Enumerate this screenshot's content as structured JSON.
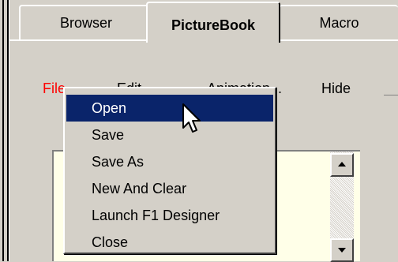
{
  "tabs": [
    {
      "label": "Browser",
      "active": false
    },
    {
      "label": "PictureBook",
      "active": true
    },
    {
      "label": "Macro",
      "active": false
    }
  ],
  "menubar": {
    "file": "File",
    "edit": "Edit",
    "animation": "Animation...",
    "hide": "Hide"
  },
  "dropdown": {
    "items": [
      {
        "label": "Open",
        "selected": true
      },
      {
        "label": "Save"
      },
      {
        "label": "Save As"
      },
      {
        "label": "New And Clear"
      },
      {
        "label": "Launch F1 Designer"
      },
      {
        "label": "Close"
      }
    ]
  },
  "colors": {
    "window_bg": "#d4d0c8",
    "menu_selection": "#0a246a",
    "active_menu_text": "#ff0000",
    "panel_bg": "#ffffe8"
  },
  "icons": {
    "cursor": "arrow-cursor-icon",
    "scroll_up": "scroll-up-arrow-icon",
    "scroll_down": "scroll-down-arrow-icon"
  }
}
